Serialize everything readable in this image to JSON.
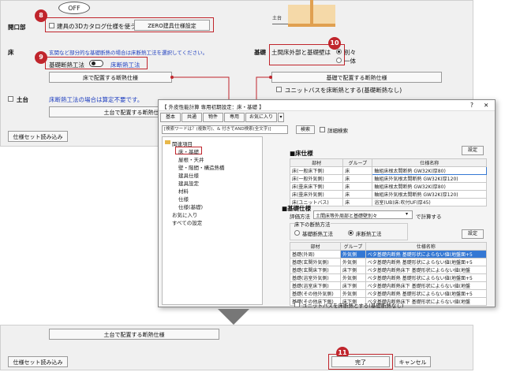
{
  "callout_off": "OFF",
  "badges": [
    "8",
    "9",
    "10",
    "11"
  ],
  "top_panel": {
    "opening_label": "開口部",
    "opening_checkbox": "建具の3Dカタログ仕様を使う",
    "zero_button": "ZERO建具仕様設定",
    "floor_label": "床",
    "floor_note": "玄関など部分的な基礎断熱の場合は床断熱工法を選択してください。",
    "foundation_toggle_label": "基礎断熱工法",
    "floor_insulation_label": "床断熱工法",
    "floor_spec_button": "床で配置する断熱仕様",
    "base_label": "基礎",
    "earth_floor_label": "土間床外部と基礎壁は",
    "separate_option": "別々",
    "together_option": "一体",
    "base_spec_button": "基礎で配置する断熱仕様",
    "unitbath_checkbox": "ユニットバスを床断熱とする(基礎断熱なし)",
    "sill_label": "土台",
    "sill_note": "床断熱工法の場合は算定不要です。",
    "sill_spec_button": "土台で配置する断熱仕様",
    "spec_set_button": "仕様セット読み込み",
    "house_label": "土台"
  },
  "dialog": {
    "title": "【 外皮性能計算 専用初期設定：床・基礎 】",
    "help": "?",
    "close": "✕",
    "toolbar": [
      "基本",
      "共通",
      "物件",
      "専用",
      "お気に入り"
    ],
    "search_placeholder": "[検索ワードは？(複数可)、& 付きでAND検索(全文字)]",
    "search_button": "検索",
    "detail_search": "詳細検索",
    "tree": {
      "root": "関連項目",
      "items": [
        "床・基礎",
        "屋根・天井",
        "壁・階間・構造熱橋",
        "建具仕様",
        "建具設定",
        "材料",
        "仕様",
        "仕様(基礎)"
      ],
      "favorites": "お気に入り",
      "all_settings": "すべての設定"
    },
    "floor_section": {
      "title": "■床仕様",
      "settings_button": "設定",
      "headers": [
        "部材",
        "グループ",
        "仕様名称"
      ],
      "rows": [
        [
          "床(一般床下側)",
          "床",
          "軸組床根太間断熱 GW32K(厚80)"
        ],
        [
          "床(一般外気側)",
          "床",
          "軸組床外気根太間断熱 GW32K(厚120)"
        ],
        [
          "床(畳床床下側)",
          "床",
          "軸組床根太間断熱 GW32K(厚80)"
        ],
        [
          "床(畳床外気側)",
          "床",
          "軸組床外気根太間断熱 GW32K(厚120)"
        ],
        [
          "床(ユニットバス)",
          "床",
          "浴室(UB)床:吹付UF(厚45)"
        ]
      ]
    },
    "base_section": {
      "title": "■基礎仕様",
      "method_label": "評価方法",
      "method_value": "土間床等外周部と基礎壁別々",
      "method_suffix": "で計算する",
      "under_floor_label": "床下の断熱方法",
      "foundation_option": "基礎断熱工法",
      "floor_option": "床断熱工法",
      "settings_button": "設定",
      "headers": [
        "部材",
        "グループ",
        "仕様名称"
      ],
      "rows": [
        [
          "基礎(外周)",
          "外気側",
          "べタ基礎内断熱 基礎形状によらない値(地盤面+5"
        ],
        [
          "基礎(玄関外気側)",
          "外気側",
          "べタ基礎内断熱 基礎形状によらない値(地盤面+5"
        ],
        [
          "基礎(玄関床下側)",
          "床下側",
          "べタ基礎内断熱床下 基礎形状によらない値(地盤"
        ],
        [
          "基礎(浴室外気側)",
          "外気側",
          "べタ基礎内断熱 基礎形状によらない値(地盤面+5"
        ],
        [
          "基礎(浴室床下側)",
          "床下側",
          "べタ基礎内断熱床下 基礎形状によらない値(地盤"
        ],
        [
          "基礎(その他外気側)",
          "外気側",
          "べタ基礎内断熱 基礎形状によらない値(地盤面+5"
        ],
        [
          "基礎(その他床下側)",
          "床下側",
          "べタ基礎内断熱床下 基礎形状によらない値(地盤"
        ]
      ]
    },
    "unitbath_checkbox": "ユニットバスを床断熱とする(基礎断熱なし)"
  },
  "bottom_panel": {
    "sill_spec_button": "土台で配置する断熱仕様",
    "spec_set_button": "仕様セット読み込み",
    "ok_button": "完了",
    "cancel_button": "キャンセル"
  }
}
